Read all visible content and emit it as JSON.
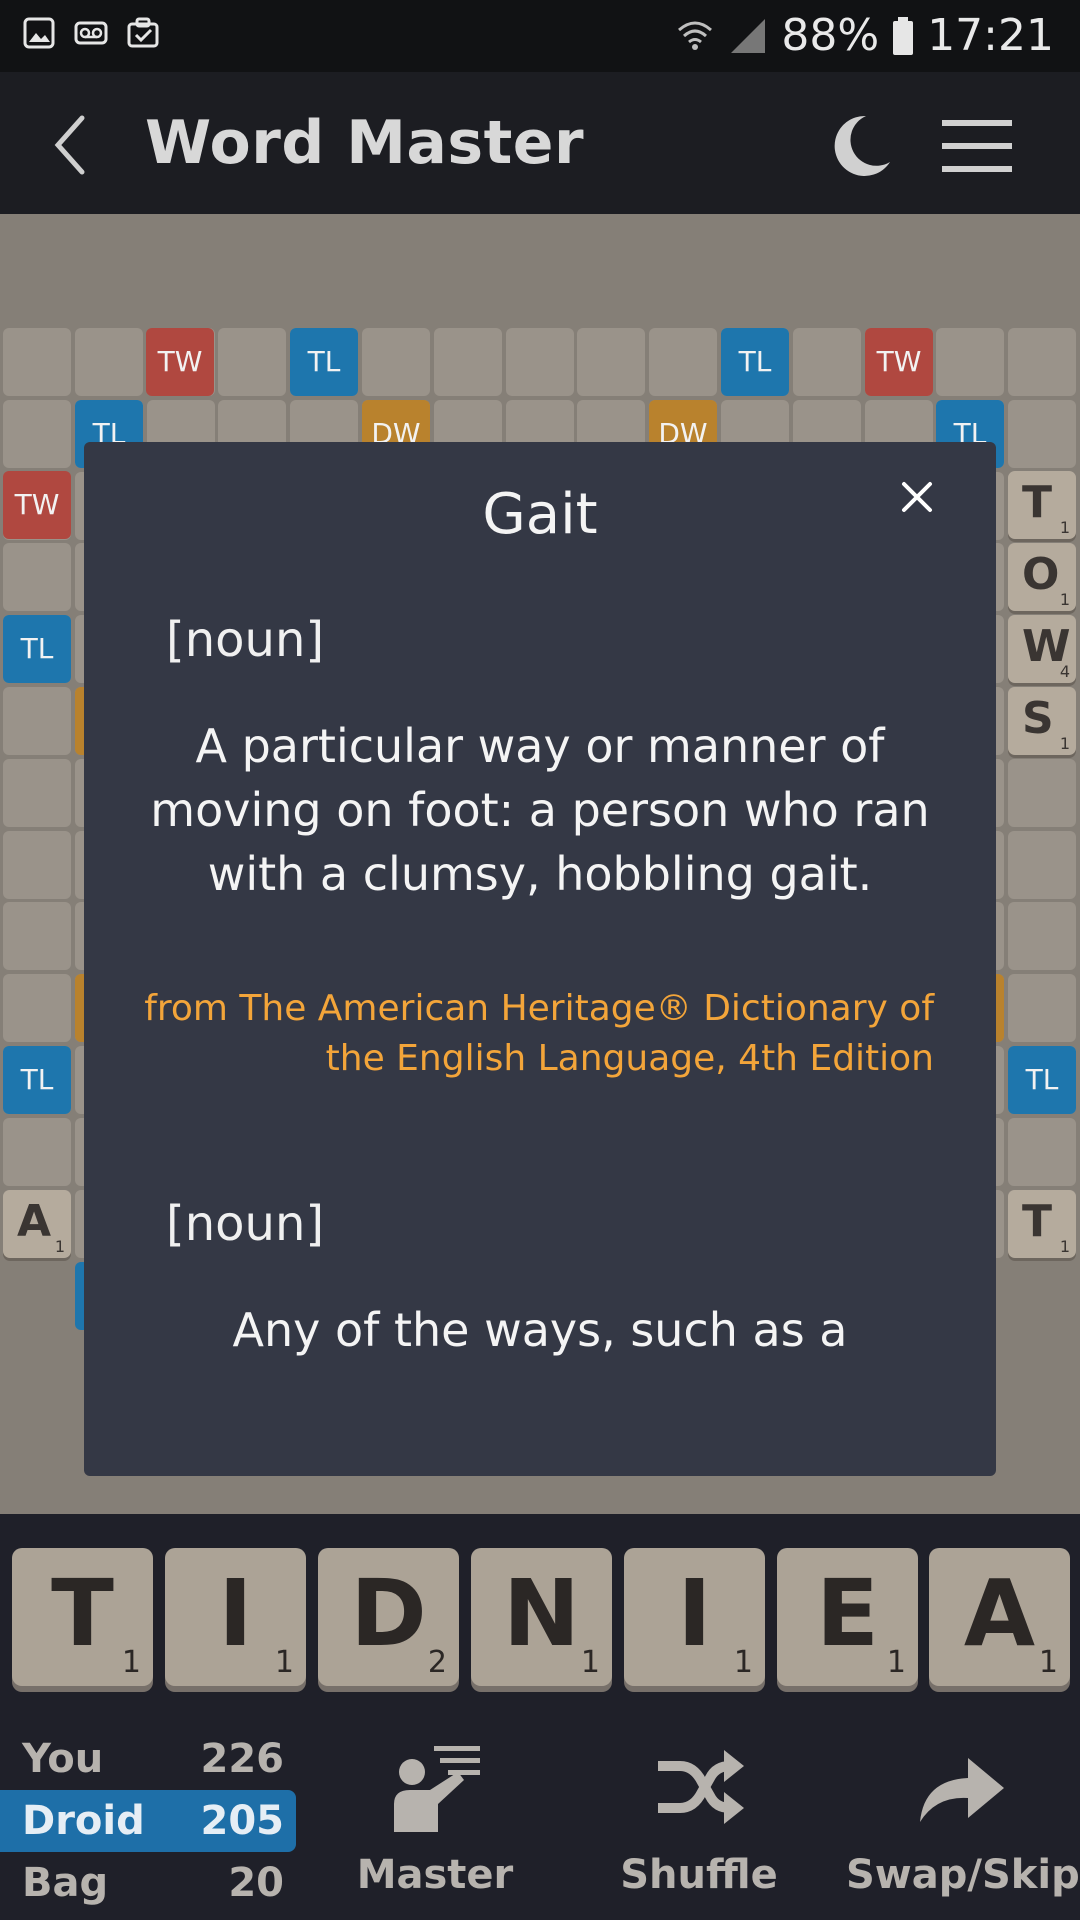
{
  "status_bar": {
    "battery": "88%",
    "time": "17:21"
  },
  "app_bar": {
    "title": "Word Master"
  },
  "board": {
    "premium_labels": {
      "tw": "TW",
      "tl": "TL",
      "dw": "DW"
    },
    "tiles_right": [
      {
        "letter": "T",
        "score": "1"
      },
      {
        "letter": "O",
        "score": "1"
      },
      {
        "letter": "W",
        "score": "4"
      },
      {
        "letter": "S",
        "score": "1"
      }
    ],
    "tile_left_a": {
      "letter": "A",
      "score": "1"
    },
    "tile_right_t": {
      "letter": "T",
      "score": "1"
    }
  },
  "modal": {
    "title": "Gait",
    "entries": [
      {
        "pos": "[noun]",
        "definition": "A particular way or manner of moving on foot:  a person who ran with a clumsy, hobbling gait.",
        "source": "from The American Heritage® Dictionary of the English Language, 4th Edition"
      },
      {
        "pos": "[noun]",
        "definition": "Any of the ways, such as a"
      }
    ]
  },
  "rack": [
    {
      "letter": "T",
      "score": "1"
    },
    {
      "letter": "I",
      "score": "1"
    },
    {
      "letter": "D",
      "score": "2"
    },
    {
      "letter": "N",
      "score": "1"
    },
    {
      "letter": "I",
      "score": "1"
    },
    {
      "letter": "E",
      "score": "1"
    },
    {
      "letter": "A",
      "score": "1"
    }
  ],
  "scores": [
    {
      "name": "You",
      "value": "226",
      "active": false
    },
    {
      "name": "Droid",
      "value": "205",
      "active": true
    },
    {
      "name": "Bag",
      "value": "20",
      "active": false
    }
  ],
  "actions": {
    "master": "Master",
    "shuffle": "Shuffle",
    "swap": "Swap/Skip"
  },
  "colors": {
    "triple_word": "#b04840",
    "triple_letter": "#1e76ad",
    "double_word": "#b9822d",
    "source_text": "#f3a53a",
    "active_player": "#1e6fa8"
  }
}
